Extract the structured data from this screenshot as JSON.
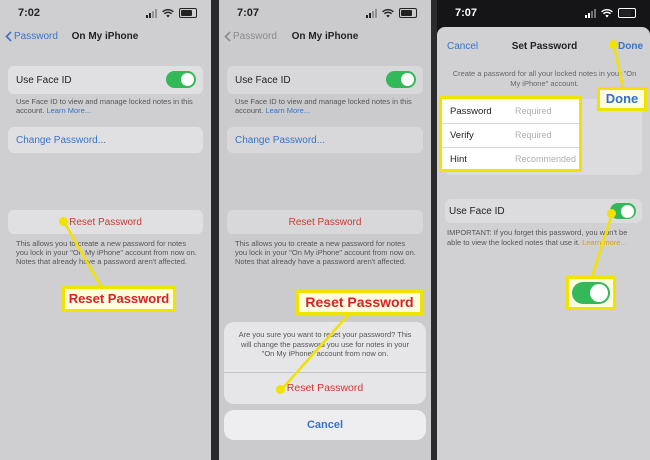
{
  "panel1": {
    "time": "7:02",
    "back_label": "Password",
    "title": "On My iPhone",
    "face_id_label": "Use Face ID",
    "face_id_desc": "Use Face ID to view and manage locked notes in this account.",
    "learn_more": "Learn More...",
    "change_password": "Change Password...",
    "reset_password": "Reset Password",
    "reset_desc": "This allows you to create a new password for notes you lock in your \"On My iPhone\" account from now on. Notes that already have a password aren't affected.",
    "callout": "Reset Password"
  },
  "panel2": {
    "time": "7:07",
    "back_label": "Password",
    "title": "On My iPhone",
    "face_id_label": "Use Face ID",
    "face_id_desc": "Use Face ID to view and manage locked notes in this account.",
    "learn_more": "Learn More...",
    "change_password": "Change Password...",
    "reset_password": "Reset Password",
    "reset_desc": "This allows you to create a new password for notes you lock in your \"On My iPhone\" account from now on. Notes that already have a password aren't affected.",
    "callout": "Reset Password",
    "sheet_message": "Are you sure you want to reset your password? This will change the password you use for notes in your \"On My iPhone\" account from now on.",
    "sheet_action": "Reset Password",
    "cancel": "Cancel"
  },
  "panel3": {
    "time": "7:07",
    "cancel": "Cancel",
    "title": "Set Password",
    "done": "Done",
    "description": "Create a password for all your locked notes in your \"On My iPhone\" account.",
    "password_label": "Password",
    "password_placeholder": "Required",
    "verify_label": "Verify",
    "verify_placeholder": "Required",
    "hint_label": "Hint",
    "hint_placeholder": "Recommended",
    "face_id_label": "Use Face ID",
    "important": "IMPORTANT: If you forget this password, you won't be able to view the locked notes that use it.",
    "learn_more": "Learn more...",
    "callout_done": "Done"
  },
  "colors": {
    "callout_border": "#f2e200",
    "callout_text": "#d92025",
    "toggle_on": "#33b85a",
    "link": "#3874c8"
  }
}
